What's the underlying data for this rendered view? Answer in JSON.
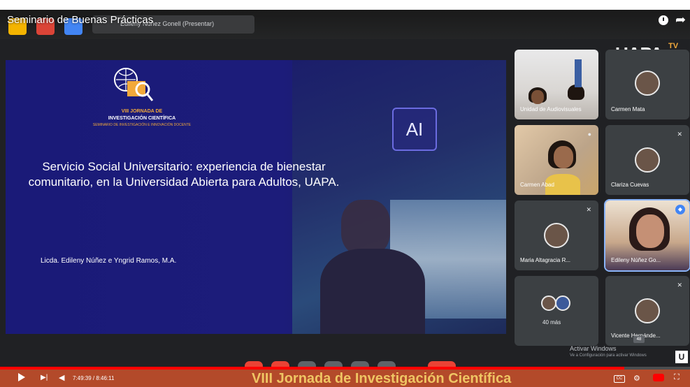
{
  "video": {
    "title": "Seminario de Buenas Prácticas",
    "presenter_chip": "Edileny Núñez Gonell (Presentar)",
    "timecode": "7:49:39 / 8:46:11",
    "progress_fraction": 0.905,
    "chapter_overlay": "VIII Jornada de Investigación Científica"
  },
  "slide": {
    "logo_line1": "VIII JORNADA DE",
    "logo_line2": "INVESTIGACIÓN CIENTÍFICA",
    "logo_line3": "SEMINARIO DE INVESTIGACIÓN E INNOVACIÓN DOCENTE",
    "ai_label": "AI",
    "title": "Servicio Social Universitario: experiencia de bienestar comunitario, en la Universidad Abierta para Adultos, UAPA.",
    "authors": "Licda. Edileny Núñez e Yngrid Ramos, M.A."
  },
  "branding": {
    "logo_text": "UAPA",
    "logo_suffix": "TV"
  },
  "participants": [
    {
      "name": "Unidad de Audiovisuales"
    },
    {
      "name": "Carmen Mata"
    },
    {
      "name": "Carmen Abad"
    },
    {
      "name": "Clariza Cuevas"
    },
    {
      "name": "Maria Altagracia R..."
    },
    {
      "name": "Edileny Núñez Go..."
    },
    {
      "name": "40 más"
    },
    {
      "name": "Vicente Hernánde..."
    }
  ],
  "system": {
    "activate_line1": "Activar Windows",
    "activate_line2": "Ve a Configuración para activar Windows",
    "u_badge": "U",
    "meet_badge": "48"
  },
  "icons": {
    "clock": "clock-icon",
    "share": "share-icon",
    "play": "play-icon",
    "next": "next-icon",
    "volume": "volume-icon",
    "cc": "captions-icon",
    "settings": "gear-icon",
    "youtube": "youtube-icon",
    "fullscreen": "fullscreen-icon"
  },
  "colors": {
    "accent_red": "#ff0000",
    "slide_blue": "#1a1a78",
    "logo_orange": "#f2a93b"
  }
}
